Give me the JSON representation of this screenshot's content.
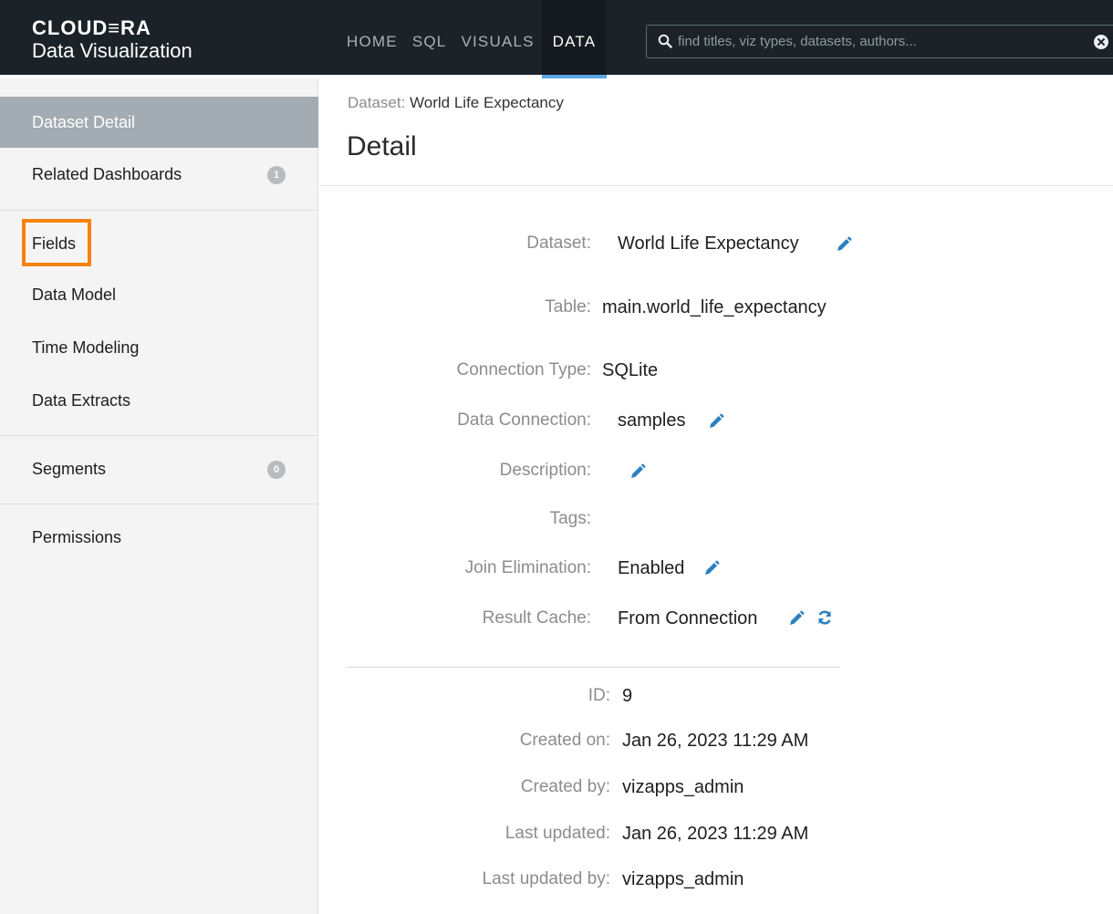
{
  "brand": {
    "name": "CLOUD≡RA",
    "product": "Data Visualization"
  },
  "nav": {
    "items": [
      {
        "label": "HOME"
      },
      {
        "label": "SQL"
      },
      {
        "label": "VISUALS"
      },
      {
        "label": "DATA",
        "active": true
      }
    ]
  },
  "search": {
    "placeholder": "find titles, viz types, datasets, authors..."
  },
  "sidebar": {
    "items": [
      {
        "label": "Dataset Detail",
        "active": true
      },
      {
        "label": "Related Dashboards",
        "badge": "1"
      },
      {
        "label": "Fields",
        "highlighted": true
      },
      {
        "label": "Data Model"
      },
      {
        "label": "Time Modeling"
      },
      {
        "label": "Data Extracts"
      },
      {
        "label": "Segments",
        "badge": "0"
      },
      {
        "label": "Permissions"
      }
    ]
  },
  "main": {
    "breadcrumb_prefix": "Dataset:",
    "breadcrumb_dataset": "World Life Expectancy",
    "title": "Detail",
    "details": {
      "dataset_label": "Dataset:",
      "dataset_value": "World Life Expectancy",
      "table_label": "Table:",
      "table_value": "main.world_life_expectancy",
      "connection_type_label": "Connection Type:",
      "connection_type_value": "SQLite",
      "data_connection_label": "Data Connection:",
      "data_connection_value": "samples",
      "description_label": "Description:",
      "description_value": "",
      "tags_label": "Tags:",
      "tags_value": "",
      "join_elimination_label": "Join Elimination:",
      "join_elimination_value": "Enabled",
      "result_cache_label": "Result Cache:",
      "result_cache_value": "From Connection"
    },
    "meta": {
      "id_label": "ID:",
      "id_value": "9",
      "created_on_label": "Created on:",
      "created_on_value": "Jan 26, 2023 11:29 AM",
      "created_by_label": "Created by:",
      "created_by_value": "vizapps_admin",
      "last_updated_label": "Last updated:",
      "last_updated_value": "Jan 26, 2023 11:29 AM",
      "last_updated_by_label": "Last updated by:",
      "last_updated_by_value": "vizapps_admin"
    }
  },
  "colors": {
    "topbar": "#1b2329",
    "accent": "#5aa9e6",
    "edit_icon": "#2d7fc1",
    "highlight": "#f7830f",
    "sidebar_active": "#a3acb2"
  }
}
